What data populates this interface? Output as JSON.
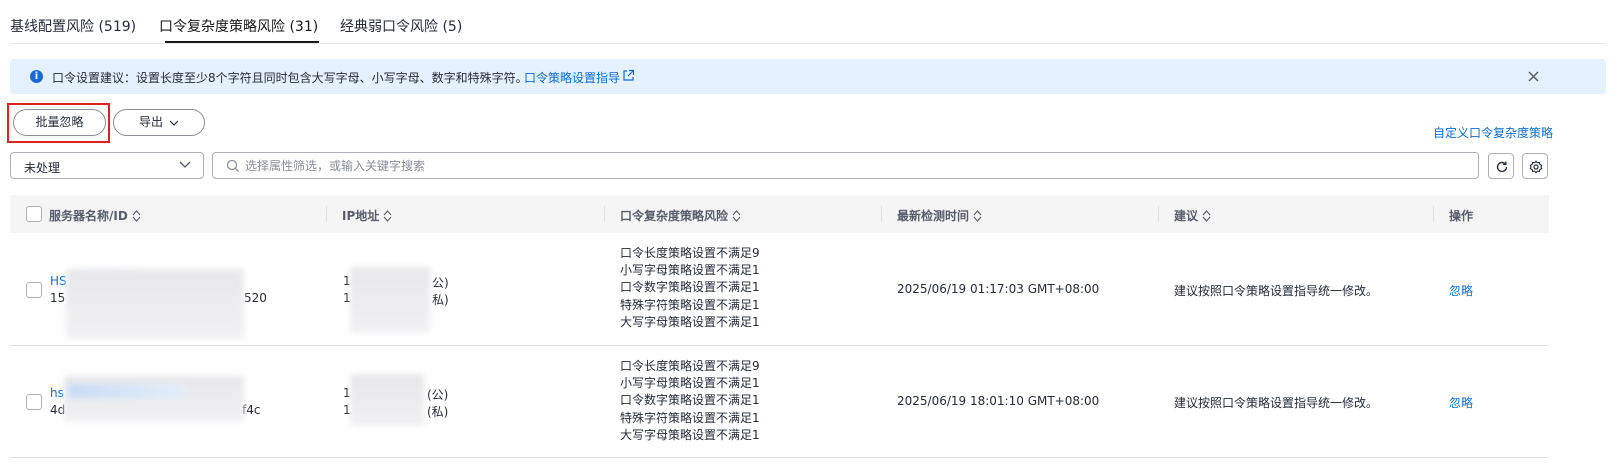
{
  "tabs": [
    {
      "label": "基线配置风险 (519)"
    },
    {
      "label": "口令复杂度策略风险 (31)"
    },
    {
      "label": "经典弱口令风险 (5)"
    }
  ],
  "alert": {
    "text": "口令设置建议：设置长度至少8个字符且同时包含大写字母、小写字母、数字和特殊字符。",
    "link": "口令策略设置指导"
  },
  "toolbar": {
    "batch_ignore": "批量忽略",
    "export": "导出",
    "custom_policy_link": "自定义口令复杂度策略"
  },
  "filter": {
    "status_value": "未处理",
    "search_placeholder": "选择属性筛选，或输入关键字搜索"
  },
  "table": {
    "columns": [
      "服务器名称/ID",
      "IP地址",
      "口令复杂度策略风险",
      "最新检测时间",
      "建议",
      "操作"
    ],
    "rows": [
      {
        "name_visible": "HS",
        "id_prefix": "15",
        "id_suffix": "520",
        "ip_1_prefix": "1",
        "ip_1_tag": "公)",
        "ip_2_prefix": "1",
        "ip_2_tag": "私)",
        "risks": [
          "口令长度策略设置不满足9",
          "小写字母策略设置不满足1",
          "口令数字策略设置不满足1",
          "特殊字符策略设置不满足1",
          "大写字母策略设置不满足1"
        ],
        "time": "2025/06/19 01:17:03 GMT+08:00",
        "suggestion": "建议按照口令策略设置指导统一修改。",
        "action": "忽略"
      },
      {
        "name_visible": "hs",
        "id_prefix": "4d",
        "id_suffix": "f4c",
        "ip_1_prefix": "1",
        "ip_1_tag": "(公)",
        "ip_2_prefix": "1",
        "ip_2_tag": "(私)",
        "risks": [
          "口令长度策略设置不满足9",
          "小写字母策略设置不满足1",
          "口令数字策略设置不满足1",
          "特殊字符策略设置不满足1",
          "大写字母策略设置不满足1"
        ],
        "time": "2025/06/19 18:01:10 GMT+08:00",
        "suggestion": "建议按照口令策略设置指导统一修改。",
        "action": "忽略"
      }
    ]
  },
  "icons": {
    "info": "info-icon",
    "external_link": "external-link-icon",
    "close": "close-icon",
    "chevron_down": "chevron-down-icon",
    "search": "search-icon",
    "refresh": "refresh-icon",
    "settings": "gear-icon",
    "sort": "sort-icon"
  },
  "colors": {
    "link": "#0a6dd6",
    "alert_bg": "#e5f1ff",
    "highlight": "#e02020"
  }
}
